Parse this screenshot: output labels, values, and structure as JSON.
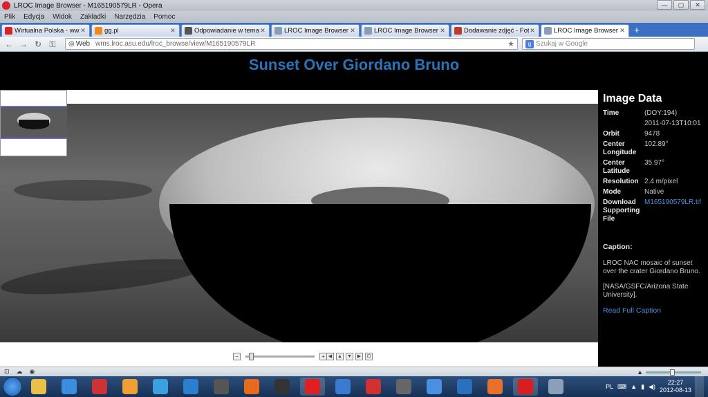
{
  "window": {
    "title": "LROC Image Browser - M165190579LR - Opera",
    "controls": [
      "—",
      "▢",
      "✕"
    ]
  },
  "menu": [
    "Plik",
    "Edycja",
    "Widok",
    "Zakładki",
    "Narzędzia",
    "Pomoc"
  ],
  "tabs": [
    {
      "label": "Wirtualna Polska - ww...",
      "icon_color": "#d8232a"
    },
    {
      "label": "gg.pl",
      "icon_color": "#f08a1a"
    },
    {
      "label": "Odpowiadanie w tema...",
      "icon_color": "#555555"
    },
    {
      "label": "LROC Image Browser",
      "icon_color": "#8a9db8"
    },
    {
      "label": "LROC Image Browser - ...",
      "icon_color": "#8a9db8"
    },
    {
      "label": "Dodawanie zdjęć - Fot...",
      "icon_color": "#c0392b"
    },
    {
      "label": "LROC Image Browser - ...",
      "icon_color": "#8a9db8"
    }
  ],
  "address": {
    "badge": "Web",
    "url": "wms.lroc.asu.edu/lroc_browse/view/M165190579LR",
    "search_placeholder": "Szukaj w Google"
  },
  "page": {
    "title": "Sunset Over Giordano Bruno"
  },
  "image_data": {
    "heading": "Image Data",
    "rows": [
      {
        "key": "Time",
        "value": "(DOY:194)"
      },
      {
        "key": "",
        "value": "2011-07-13T10:01"
      },
      {
        "key": "Orbit",
        "value": "9478"
      },
      {
        "key": "Center Longitude",
        "value": "102.89°"
      },
      {
        "key": "Center Latitude",
        "value": "35.97°"
      },
      {
        "key": "Resolution",
        "value": "2.4 m/pixel"
      },
      {
        "key": "Mode",
        "value": "Native"
      },
      {
        "key": "Download Supporting File",
        "value": "M165190579LR.tif"
      }
    ],
    "caption_heading": "Caption:",
    "caption": "LROC NAC mosaic of sunset over the crater Giordano Bruno.",
    "credit": "[NASA/GSFC/Arizona State University].",
    "read_more": "Read Full Caption"
  },
  "viewer": {
    "zoom_level": 0.05
  },
  "taskbar": {
    "icons": [
      {
        "name": "file-explorer-icon",
        "color": "#e8c04a"
      },
      {
        "name": "flash-icon",
        "color": "#3b8de0"
      },
      {
        "name": "network-icon",
        "color": "#cc3333"
      },
      {
        "name": "media-player-icon",
        "color": "#f0a030"
      },
      {
        "name": "sync-icon",
        "color": "#3aa0e0"
      },
      {
        "name": "bc-icon",
        "color": "#2a7fd0"
      },
      {
        "name": "paint-icon",
        "color": "#555555"
      },
      {
        "name": "orange-app-icon",
        "color": "#e86a1a"
      },
      {
        "name": "ea-icon",
        "color": "#333333"
      },
      {
        "name": "red-app-icon",
        "color": "#e02020"
      },
      {
        "name": "globe-icon",
        "color": "#3a7ad0"
      },
      {
        "name": "ccleaner-icon",
        "color": "#d03030"
      },
      {
        "name": "game-icon",
        "color": "#666666"
      },
      {
        "name": "chat-icon",
        "color": "#4a90e0"
      },
      {
        "name": "monitor-icon",
        "color": "#2a6fc0"
      },
      {
        "name": "firefox-icon",
        "color": "#e8702a"
      },
      {
        "name": "opera-icon",
        "color": "#d81e1e"
      },
      {
        "name": "settings-icon",
        "color": "#8aa0b8"
      }
    ],
    "language": "PL",
    "time": "22:27",
    "date": "2012-08-13"
  }
}
